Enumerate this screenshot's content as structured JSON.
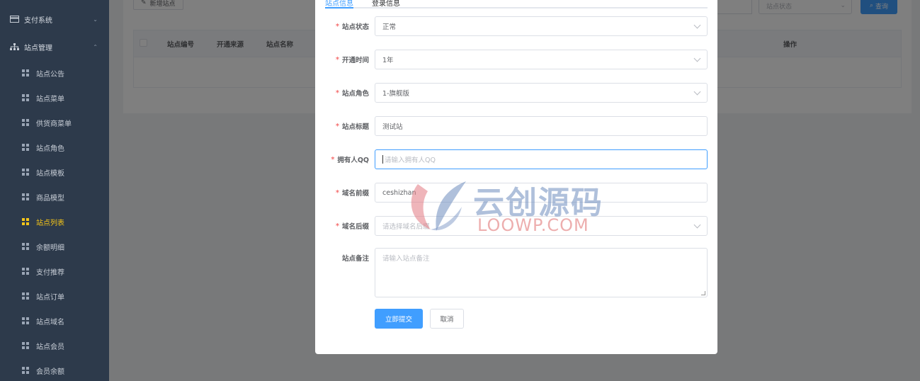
{
  "sidebar": {
    "groups": [
      {
        "label": "支付系统",
        "icon": "card-icon",
        "expanded": false
      },
      {
        "label": "站点管理",
        "icon": "sitemap-icon",
        "expanded": true
      }
    ],
    "items": [
      {
        "label": "站点公告"
      },
      {
        "label": "站点菜单"
      },
      {
        "label": "供货商菜单"
      },
      {
        "label": "站点角色"
      },
      {
        "label": "站点模板"
      },
      {
        "label": "商品模型"
      },
      {
        "label": "站点列表",
        "active": true
      },
      {
        "label": "余额明细"
      },
      {
        "label": "支付推荐"
      },
      {
        "label": "站点订单"
      },
      {
        "label": "站点域名"
      },
      {
        "label": "站点会员"
      },
      {
        "label": "会员余额"
      }
    ]
  },
  "toolbar": {
    "add_label": "新增站点",
    "status_placeholder": "站点状态",
    "query_label": "查询"
  },
  "table": {
    "headers": [
      "站点编号",
      "开通来源",
      "站点名称",
      "操作"
    ]
  },
  "dialog": {
    "tabs": [
      "站点信息",
      "登录信息"
    ],
    "fields": [
      {
        "label": "站点状态",
        "required": true,
        "type": "select",
        "value": "正常"
      },
      {
        "label": "开通时间",
        "required": true,
        "type": "select",
        "value": "1年"
      },
      {
        "label": "站点角色",
        "required": true,
        "type": "select",
        "value": "1-旗舰版"
      },
      {
        "label": "站点标题",
        "required": true,
        "type": "input",
        "value": "测试站"
      },
      {
        "label": "拥有人QQ",
        "required": true,
        "type": "input",
        "value": "",
        "placeholder": "请输入拥有人QQ",
        "focused": true
      },
      {
        "label": "域名前缀",
        "required": true,
        "type": "input",
        "value": "ceshizhan"
      },
      {
        "label": "域名后缀",
        "required": true,
        "type": "select",
        "value": "",
        "placeholder": "请选择域名后缀"
      },
      {
        "label": "站点备注",
        "required": false,
        "type": "textarea",
        "value": "",
        "placeholder": "请输入站点备注"
      }
    ],
    "submit_label": "立即提交",
    "cancel_label": "取消"
  },
  "watermark": {
    "cn": "云创源码",
    "en": "LOOWP.COM"
  }
}
